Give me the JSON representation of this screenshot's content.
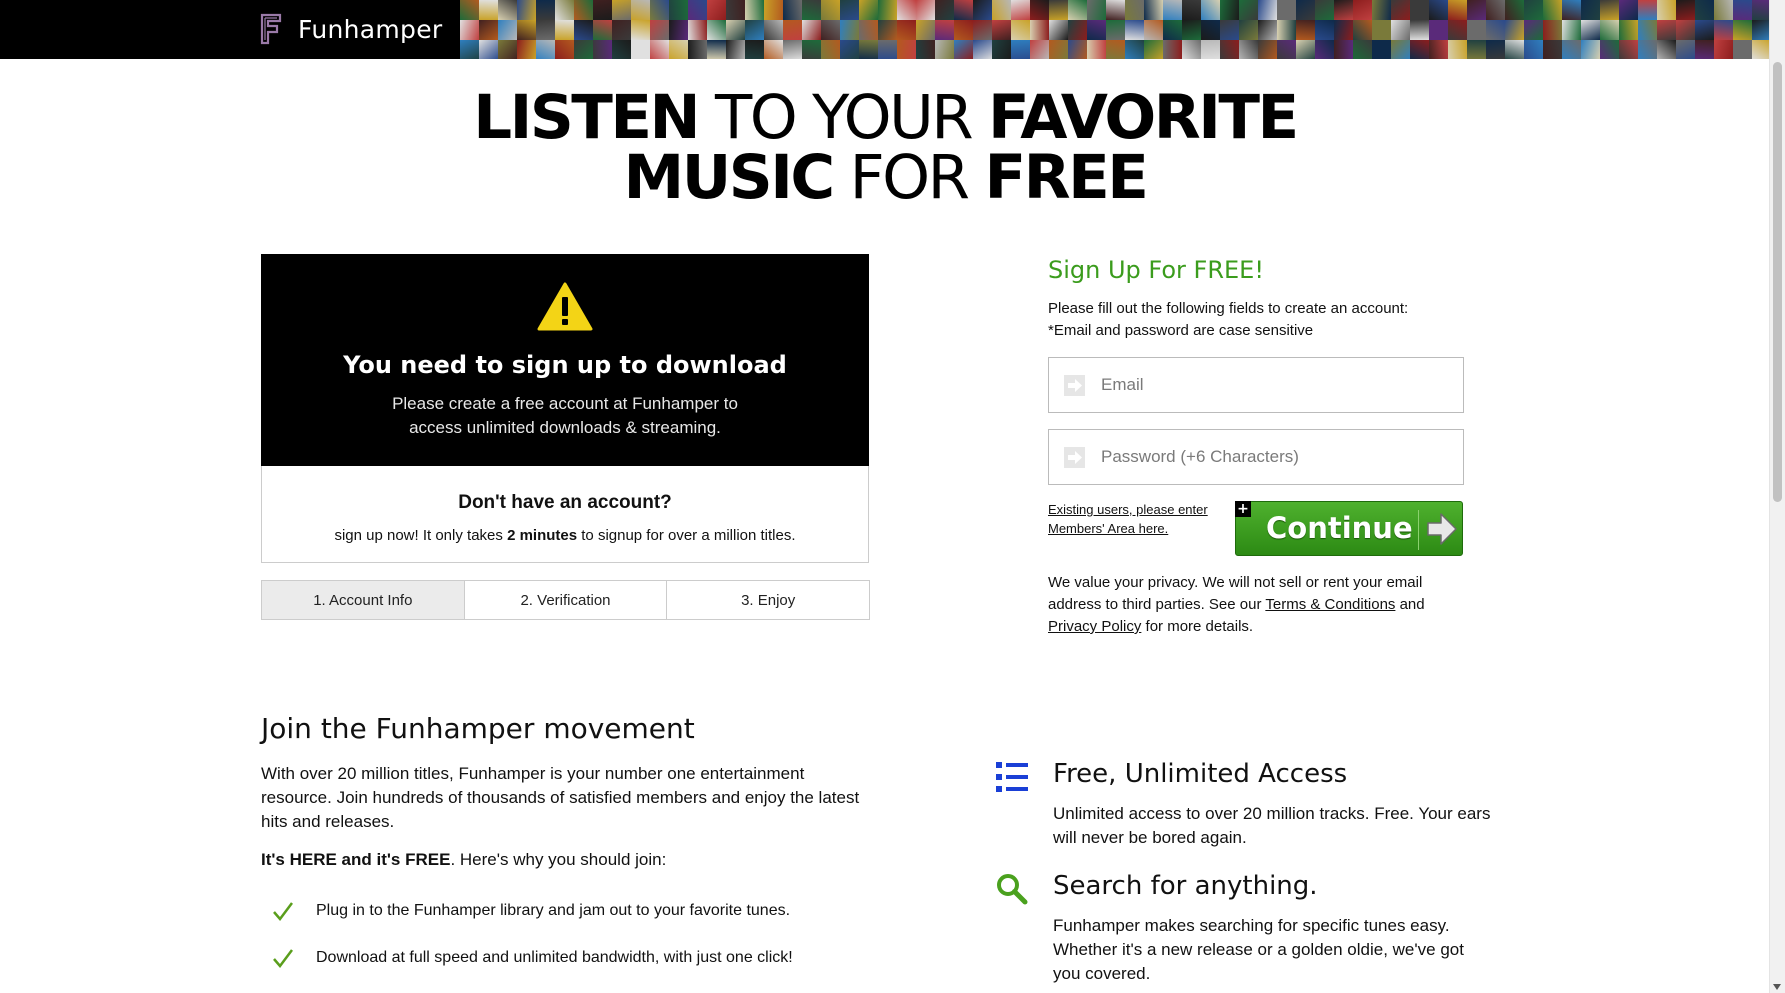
{
  "brand": {
    "name": "Funhamper"
  },
  "headline": {
    "line1": [
      {
        "text": "LISTEN",
        "bold": true
      },
      {
        "text": " TO YOUR ",
        "bold": false
      },
      {
        "text": "FAVORITE",
        "bold": true
      }
    ],
    "line2": [
      {
        "text": "MUSIC",
        "bold": true
      },
      {
        "text": " FOR ",
        "bold": false
      },
      {
        "text": "FREE",
        "bold": true
      }
    ]
  },
  "alert": {
    "icon": "warning-icon",
    "title": "You need to sign up to download",
    "text": "Please create a free account at Funhamper to access unlimited downloads & streaming."
  },
  "account": {
    "title": "Don't have an account?",
    "text_before": "sign up now! It only takes ",
    "text_bold": "2 minutes",
    "text_after": " to signup for over a million titles."
  },
  "steps": [
    "1. Account Info",
    "2. Verification",
    "3. Enjoy"
  ],
  "signup": {
    "title": "Sign Up For FREE!",
    "line1": "Please fill out the following fields to create an account:",
    "line2": "*Email and password are case sensitive",
    "email_placeholder": "Email",
    "password_placeholder": "Password (+6 Characters)",
    "existing_line1": "Existing users, please enter",
    "existing_line2": "Members' Area here.",
    "continue_label": "Continue",
    "privacy_before": "We value your privacy. We will not sell or rent your email address to third parties. See our ",
    "terms_link": "Terms & Conditions",
    "privacy_mid": " and ",
    "privacy_link": "Privacy Policy",
    "privacy_after": " for more details.",
    "accent": "#3b9c1d"
  },
  "movement": {
    "title": "Join the Funhamper movement",
    "text": "With over 20 million titles, Funhamper is your number one entertainment resource. Join hundreds of thousands of satisfied members and enjoy the latest hits and releases.",
    "here_bold": "It's HERE and it's FREE",
    "here_rest": ". Here's why you should join:",
    "checks": [
      "Plug in to the Funhamper library and jam out to your favorite tunes.",
      "Download at full speed and unlimited bandwidth, with just one click!"
    ]
  },
  "features": [
    {
      "icon": "list-icon",
      "title": "Free, Unlimited Access",
      "text": "Unlimited access to over 20 million tracks. Free. Your ears will never be bored again."
    },
    {
      "icon": "search-icon",
      "title": "Search for anything.",
      "text": "Funhamper makes searching for specific tunes easy. Whether it's a new release or a golden oldie, we've got you covered."
    }
  ]
}
